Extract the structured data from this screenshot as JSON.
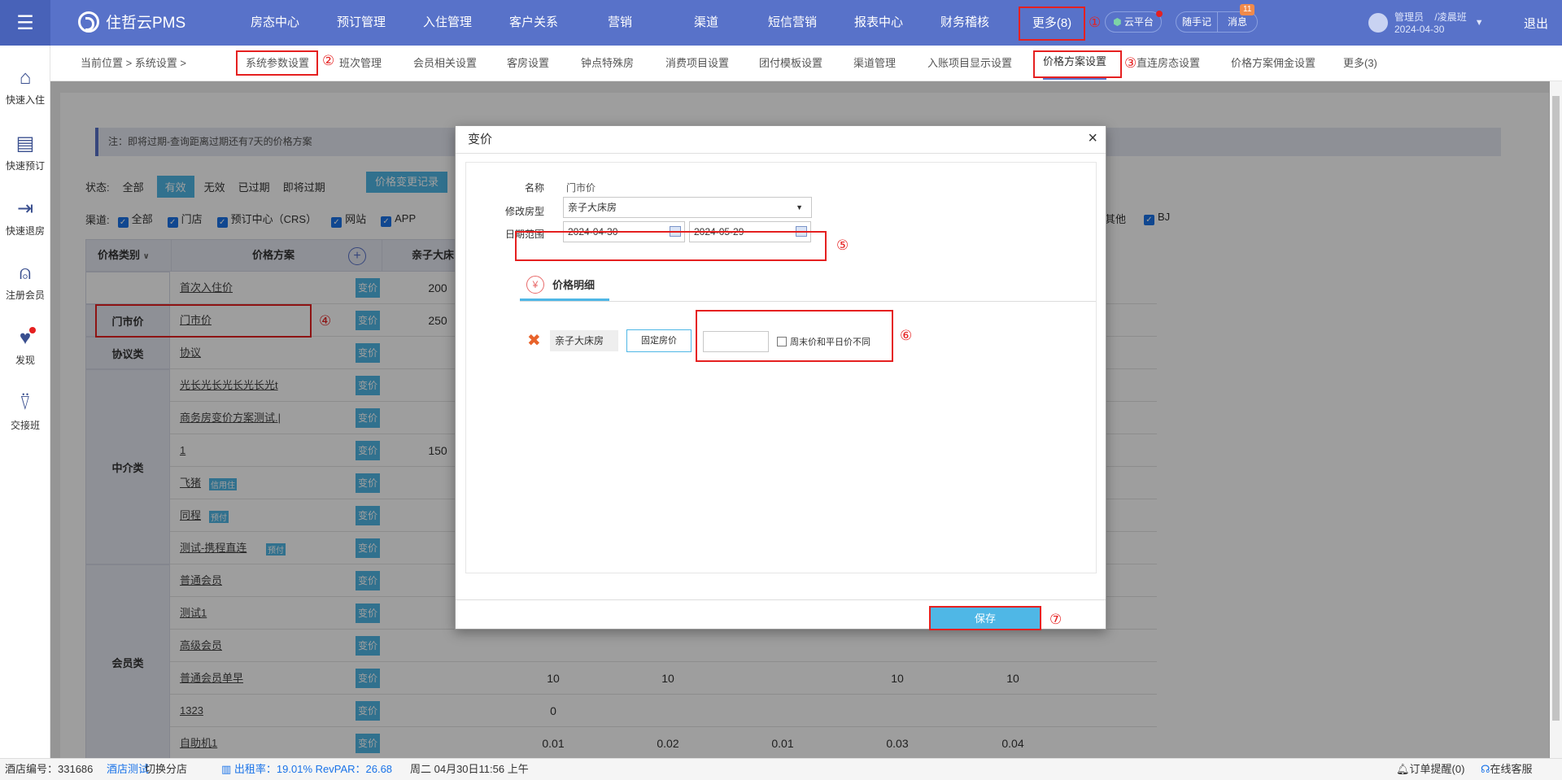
{
  "app": {
    "logo": "住哲云PMS"
  },
  "nav": {
    "items": [
      "房态中心",
      "预订管理",
      "入住管理",
      "客户关系",
      "营销",
      "渠道",
      "短信营销",
      "报表中心",
      "财务稽核"
    ],
    "more": "更多(8)",
    "cloud": "云平台",
    "notes": "随手记",
    "message": "消息",
    "message_count": "11",
    "user": "管理员",
    "shift": "/凌晨班",
    "date": "2024-04-30",
    "logout": "退出"
  },
  "annotations": [
    "①",
    "②",
    "③",
    "④",
    "⑤",
    "⑥",
    "⑦"
  ],
  "sidebar": [
    "快速入住",
    "快速预订",
    "快速退房",
    "注册会员",
    "发现",
    "交接班"
  ],
  "breadcrumb": {
    "label": "当前位置 > 系统设置 >",
    "tabs": [
      "系统参数设置",
      "班次管理",
      "会员相关设置",
      "客房设置",
      "钟点特殊房",
      "消费项目设置",
      "团付模板设置",
      "渠道管理",
      "入账项目显示设置",
      "价格方案设置",
      "直连房态设置",
      "价格方案佣金设置",
      "更多(3)"
    ]
  },
  "note": "注：即将过期-查询距离过期还有7天的价格方案",
  "status": {
    "label": "状态:",
    "options": [
      "全部",
      "有效",
      "无效",
      "已过期",
      "即将过期"
    ],
    "history_btn": "价格变更记录"
  },
  "channels": {
    "label": "渠道:",
    "items": [
      "全部",
      "门店",
      "预订中心（CRS）",
      "网站",
      "APP"
    ],
    "right_items": [
      "其他",
      "BJ"
    ]
  },
  "table": {
    "headers": [
      "价格类别",
      "价格方案",
      "亲子大床"
    ],
    "change_label": "变价",
    "categories": [
      "门市价",
      "协议类",
      "中介类",
      "会员类"
    ],
    "rows": [
      {
        "name": "首次入住价",
        "v": [
          "200",
          "",
          "",
          "",
          "",
          ""
        ]
      },
      {
        "name": "门市价",
        "v": [
          "250",
          "",
          "",
          "",
          "",
          ""
        ]
      },
      {
        "name": "协议",
        "v": [
          "",
          "",
          "",
          "",
          "",
          ""
        ]
      },
      {
        "name": "光长光长光长光长光t",
        "v": [
          "",
          "",
          "",
          "",
          "",
          ""
        ]
      },
      {
        "name": "商务房变价方案测试.|",
        "v": [
          "",
          "",
          "",
          "",
          "",
          ""
        ]
      },
      {
        "name": "1",
        "v": [
          "150",
          "",
          "",
          "",
          "",
          ""
        ]
      },
      {
        "name": "飞猪",
        "tag": "信用住",
        "v": [
          "",
          "",
          "",
          "",
          "",
          ""
        ]
      },
      {
        "name": "同程",
        "tag": "预付",
        "v": [
          "",
          "",
          "",
          "",
          "",
          ""
        ]
      },
      {
        "name": "测试-携程直连",
        "tag": "预付",
        "v": [
          "",
          "",
          "",
          "",
          "",
          ""
        ]
      },
      {
        "name": "普通会员",
        "v": [
          "",
          "",
          "",
          "",
          "",
          ""
        ]
      },
      {
        "name": "测试1",
        "v": [
          "",
          "",
          "",
          "",
          "",
          ""
        ]
      },
      {
        "name": "高级会员",
        "v": [
          "",
          "",
          "",
          "",
          "",
          ""
        ]
      },
      {
        "name": "普通会员单早",
        "v": [
          "",
          "10",
          "10",
          "",
          "10",
          "10"
        ]
      },
      {
        "name": "1323",
        "v": [
          "",
          "0",
          "",
          "",
          "",
          ""
        ]
      },
      {
        "name": "自助机1",
        "v": [
          "",
          "0.01",
          "0.02",
          "0.01",
          "0.03",
          "0.04"
        ]
      }
    ]
  },
  "dialog": {
    "title": "变价",
    "close": "×",
    "name_label": "名称",
    "name_value": "门市价",
    "room_label": "修改房型",
    "room_value": "亲子大床房",
    "date_label": "日期范围",
    "date_start": "2024-04-30",
    "date_end": "2024-05-29",
    "tab": "价格明细",
    "yen": "¥",
    "room_chip": "亲子大床房",
    "price_type": "固定房价",
    "price_value": "",
    "weekend_label": "周末价和平日价不同",
    "save": "保存"
  },
  "statusbar": {
    "hotel": "酒店编号：331686",
    "hotel_name": "酒店测试",
    "switch": "切换分店",
    "occupancy": "出租率：19.01% RevPAR：26.68",
    "time": "周二 04月30日11:56 上午",
    "order_alert": "订单提醒(0)",
    "service": "在线客服"
  }
}
